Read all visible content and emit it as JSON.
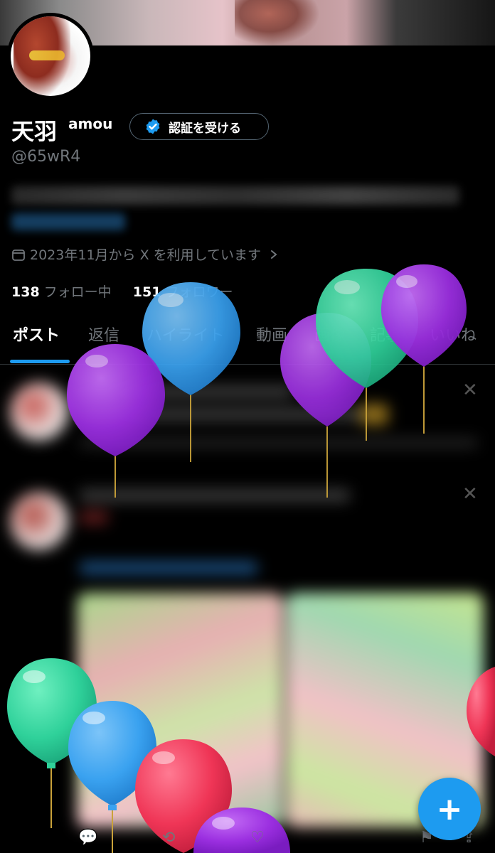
{
  "profile": {
    "display_name": "天羽",
    "display_name_sub": "amou",
    "handle": "@65wR4",
    "verify_button": "認証を受ける",
    "joined": "2023年11月から X を利用しています",
    "following_count": "138",
    "following_label": "フォロー中",
    "followers_count": "151",
    "followers_label": "フォロワー"
  },
  "tabs": [
    {
      "label": "ポスト"
    },
    {
      "label": "返信"
    },
    {
      "label": "ハイライト"
    },
    {
      "label": "動画"
    },
    {
      "label": "画像"
    },
    {
      "label": "記事"
    },
    {
      "label": "いいね"
    }
  ],
  "fab": {
    "label": "+"
  },
  "colors": {
    "accent": "#1d9bf0",
    "balloon_green": "#2fd19a",
    "balloon_purple": "#9b2fe0",
    "balloon_blue": "#3aa2f0",
    "balloon_red": "#ef3556"
  },
  "icons": [
    "verified-badge-icon",
    "calendar-icon",
    "chevron-right-icon",
    "plus-icon",
    "reply-icon",
    "repost-icon",
    "like-icon",
    "bookmark-icon",
    "share-icon"
  ]
}
